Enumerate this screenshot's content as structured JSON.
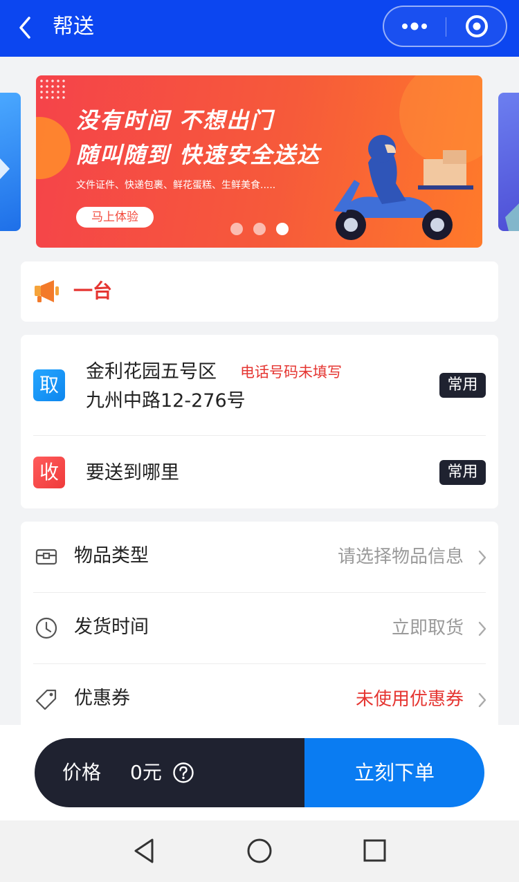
{
  "header": {
    "title": "帮送",
    "background": "#0c46f0"
  },
  "banner": {
    "line1": "没有时间 不想出门",
    "line2": "随叫随到 快速安全送达",
    "subtitle": "文件证件、快递包裹、鲜花蛋糕、生鲜美食.....",
    "cta": "马上体验",
    "carousel_total": 3,
    "carousel_active": 3
  },
  "notice": {
    "icon": "megaphone-icon",
    "text": "一台"
  },
  "address": {
    "pickup": {
      "badge": "取",
      "name": "金利花园五号区",
      "warning": "电话号码未填写",
      "detail": "九州中路12-276号",
      "tag": "常用"
    },
    "delivery": {
      "badge": "收",
      "placeholder": "要送到哪里",
      "tag": "常用"
    }
  },
  "options": [
    {
      "icon": "package-icon",
      "label": "物品类型",
      "value": "请选择物品信息",
      "value_color": "#9a9a9a"
    },
    {
      "icon": "clock-icon",
      "label": "发货时间",
      "value": "立即取货",
      "value_color": "#9a9a9a"
    },
    {
      "icon": "coupon-tag-icon",
      "label": "优惠券",
      "value": "未使用优惠券",
      "value_color": "#e53531"
    }
  ],
  "order": {
    "price_label": "价格",
    "price_value": "0元",
    "submit": "立刻下单",
    "submit_color": "#0a7cf2"
  },
  "system_nav": [
    "back-triangle-icon",
    "home-circle-icon",
    "recents-square-icon"
  ]
}
